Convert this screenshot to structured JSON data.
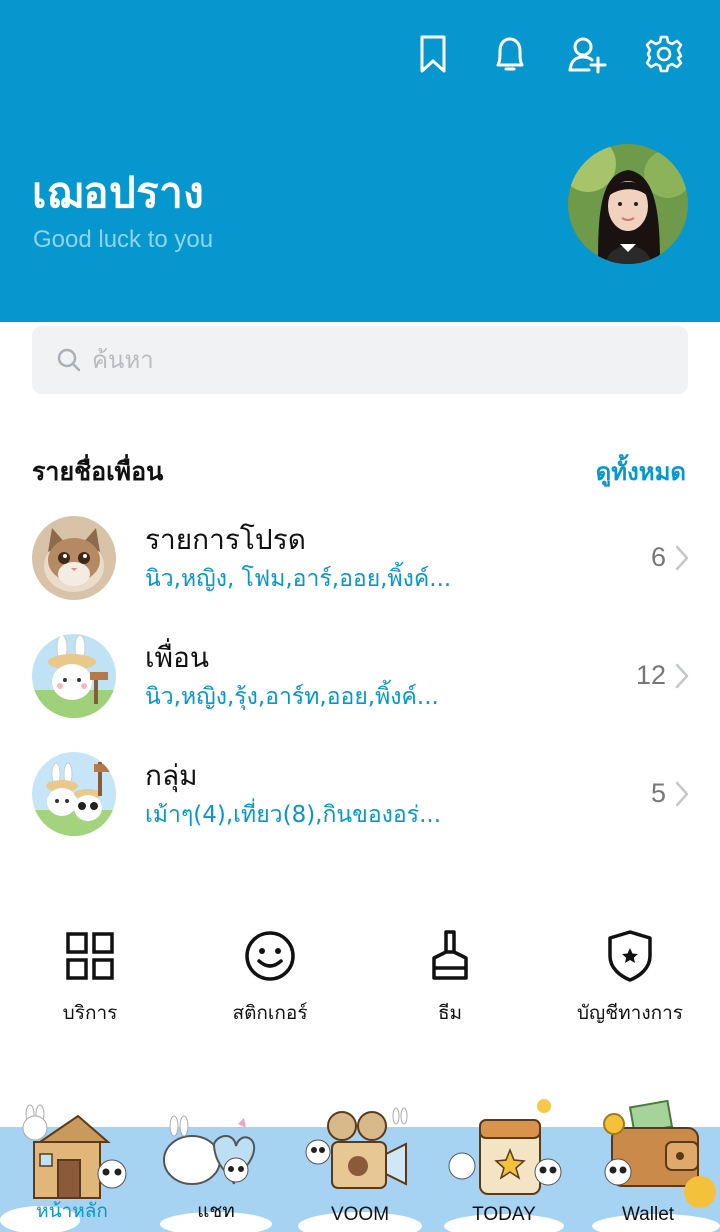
{
  "header": {
    "name": "เฌอปราง",
    "status": "Good luck to you",
    "icons": [
      "bookmark-icon",
      "bell-icon",
      "add-friend-icon",
      "gear-icon"
    ],
    "color": "#0797cf"
  },
  "search": {
    "placeholder": "ค้นหา"
  },
  "friends_section": {
    "title": "รายชื่อเพื่อน",
    "see_all": "ดูทั้งหมด",
    "rows": [
      {
        "title": "รายการโปรด",
        "subtitle": "นิว,หญิง, โฟม,อาร์,ออย,พิ้งค์...",
        "count": "6"
      },
      {
        "title": "เพื่อน",
        "subtitle": "นิว,หญิง,รุ้ง,อาร์ท,ออย,พิ้งค์...",
        "count": "12"
      },
      {
        "title": "กลุ่ม",
        "subtitle": "เม้าๆ(4),เที่ยว(8),กินของอร่...",
        "count": "5"
      }
    ]
  },
  "services": [
    {
      "label": "บริการ",
      "icon": "grid-icon"
    },
    {
      "label": "สติกเกอร์",
      "icon": "smiley-icon"
    },
    {
      "label": "ธีม",
      "icon": "brush-icon"
    },
    {
      "label": "บัญชีทางการ",
      "icon": "shield-star-icon"
    }
  ],
  "bottom_nav": [
    {
      "label": "หน้าหลัก",
      "active": true
    },
    {
      "label": "แชท",
      "active": false
    },
    {
      "label": "VOOM",
      "active": false
    },
    {
      "label": "TODAY",
      "active": false
    },
    {
      "label": "Wallet",
      "active": false
    }
  ],
  "colors": {
    "accent": "#0797cf",
    "nav_bg": "#a7d3f3"
  }
}
